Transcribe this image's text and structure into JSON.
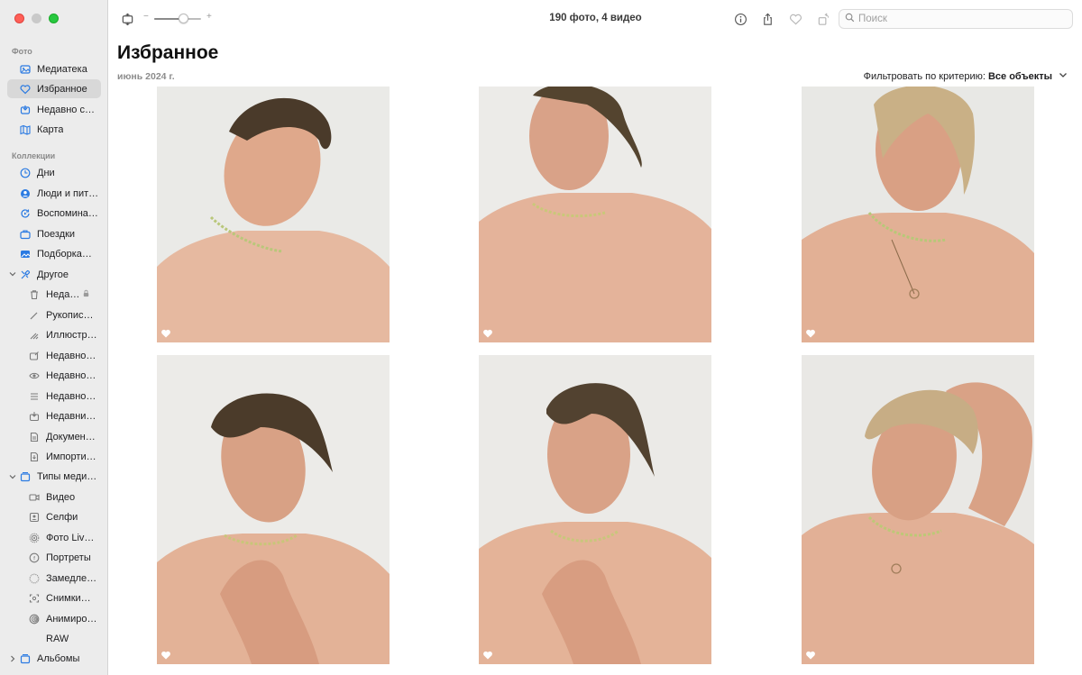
{
  "sidebar": {
    "section_photos": "Фото",
    "photos_items": [
      {
        "label": "Медиатека",
        "icon": "library-icon"
      },
      {
        "label": "Избранное",
        "icon": "heart-icon"
      },
      {
        "label": "Недавно с…",
        "icon": "recent-icon"
      },
      {
        "label": "Карта",
        "icon": "map-icon"
      }
    ],
    "section_collections": "Коллекции",
    "collection_items": [
      {
        "label": "Дни",
        "icon": "days-icon"
      },
      {
        "label": "Люди и пит…",
        "icon": "people-icon"
      },
      {
        "label": "Воспомина…",
        "icon": "memories-icon"
      },
      {
        "label": "Поездки",
        "icon": "trips-icon"
      },
      {
        "label": "Подборка…",
        "icon": "featured-icon"
      }
    ],
    "other_group": "Другое",
    "other_items": [
      {
        "label": "Неда…",
        "icon": "trash-icon"
      },
      {
        "label": "Рукопис…",
        "icon": "handwriting-icon"
      },
      {
        "label": "Иллюстр…",
        "icon": "illustrations-icon"
      },
      {
        "label": "Недавно…",
        "icon": "recently-edited-icon"
      },
      {
        "label": "Недавно…",
        "icon": "recently-viewed-icon"
      },
      {
        "label": "Недавно…",
        "icon": "recently-shared-icon"
      },
      {
        "label": "Недавни…",
        "icon": "recently-saved-icon"
      },
      {
        "label": "Докумен…",
        "icon": "documents-icon"
      },
      {
        "label": "Импорти…",
        "icon": "imports-icon"
      }
    ],
    "media_group": "Типы меди…",
    "media_items": [
      {
        "label": "Видео",
        "icon": "video-icon"
      },
      {
        "label": "Селфи",
        "icon": "selfie-icon"
      },
      {
        "label": "Фото Liv…",
        "icon": "live-photo-icon"
      },
      {
        "label": "Портреты",
        "icon": "portrait-icon"
      },
      {
        "label": "Замедле…",
        "icon": "slomo-icon"
      },
      {
        "label": "Снимки…",
        "icon": "screenshots-icon"
      },
      {
        "label": "Анимиро…",
        "icon": "animated-icon"
      },
      {
        "label": "RAW",
        "icon": "raw-icon"
      }
    ],
    "albums_group": "Альбомы"
  },
  "toolbar": {
    "title": "190 фото, 4 видео",
    "zoom_minus": "−",
    "zoom_plus": "+",
    "zoom_level": 0.62,
    "search_placeholder": "Поиск"
  },
  "main": {
    "title": "Избранное",
    "date": "июнь 2024 г.",
    "filter_label": "Фильтровать по критерию:",
    "filter_value": "Все объекты"
  },
  "photos": [
    {
      "favorite": true
    },
    {
      "favorite": true
    },
    {
      "favorite": true
    },
    {
      "favorite": true
    },
    {
      "favorite": true
    },
    {
      "favorite": true
    }
  ],
  "colors": {
    "sidebar_bg": "#ececec",
    "accent_blue": "#2a7ae2",
    "selection": "#d8d8d8"
  }
}
